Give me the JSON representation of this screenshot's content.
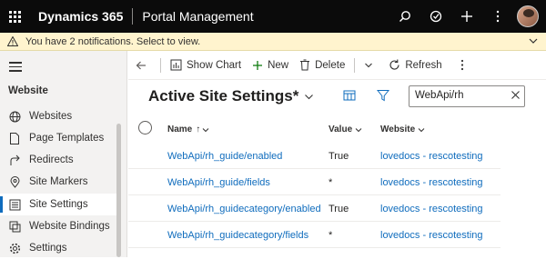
{
  "topbar": {
    "brand": "Dynamics 365",
    "app_name": "Portal Management"
  },
  "notification": {
    "text": "You have 2 notifications. Select to view."
  },
  "sidebar": {
    "section_title": "Website",
    "items": [
      {
        "label": "Websites",
        "icon": "globe-icon"
      },
      {
        "label": "Page Templates",
        "icon": "page-icon"
      },
      {
        "label": "Redirects",
        "icon": "redirect-icon"
      },
      {
        "label": "Site Markers",
        "icon": "marker-icon"
      },
      {
        "label": "Site Settings",
        "icon": "settings-list-icon",
        "active": true
      },
      {
        "label": "Website Bindings",
        "icon": "binding-icon"
      },
      {
        "label": "Settings",
        "icon": "gear-icon"
      }
    ]
  },
  "commandbar": {
    "show_chart": "Show Chart",
    "new": "New",
    "delete": "Delete",
    "refresh": "Refresh"
  },
  "view": {
    "title": "Active Site Settings*",
    "search_value": "WebApi/rh"
  },
  "grid": {
    "columns": {
      "name": "Name",
      "name_sort": "↑",
      "value": "Value",
      "website": "Website"
    },
    "rows": [
      {
        "name": "WebApi/rh_guide/enabled",
        "value": "True",
        "website": "lovedocs - rescotesting"
      },
      {
        "name": "WebApi/rh_guide/fields",
        "value": "*",
        "website": "lovedocs - rescotesting"
      },
      {
        "name": "WebApi/rh_guidecategory/enabled",
        "value": "True",
        "website": "lovedocs - rescotesting"
      },
      {
        "name": "WebApi/rh_guidecategory/fields",
        "value": "*",
        "website": "lovedocs - rescotesting"
      }
    ]
  },
  "colors": {
    "accent": "#0f6cbd",
    "topbar": "#0b0b0b",
    "notification_bg": "#fff4ce"
  }
}
